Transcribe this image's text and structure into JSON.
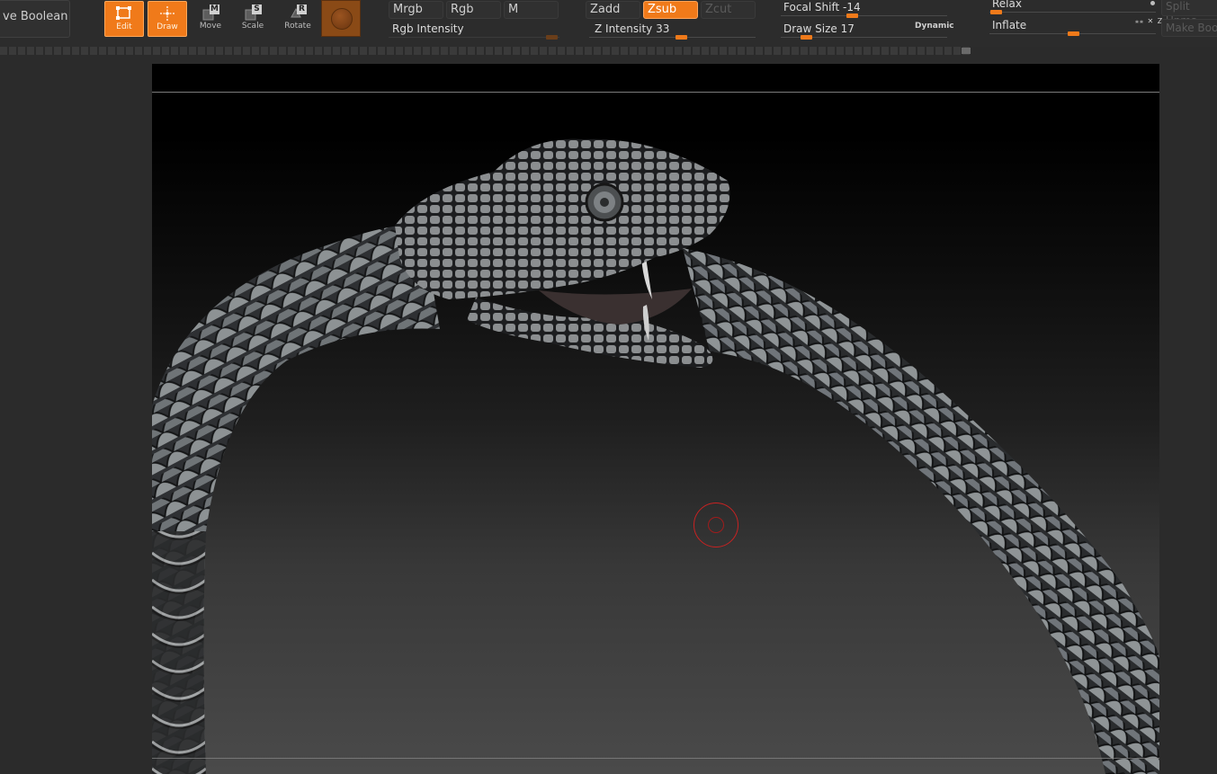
{
  "toolbar": {
    "boolean_button": "ve Boolean",
    "tools": {
      "edit": "Edit",
      "draw": "Draw",
      "move": "Move",
      "move_key": "M",
      "scale": "Scale",
      "scale_key": "S",
      "rotate": "Rotate",
      "rotate_key": "R"
    },
    "color_modes": {
      "mrgb": "Mrgb",
      "rgb": "Rgb",
      "m": "M",
      "rgb_intensity": "Rgb Intensity"
    },
    "depth_modes": {
      "zadd": "Zadd",
      "zsub": "Zsub",
      "zcut": "Zcut",
      "z_intensity_label": "Z Intensity 33",
      "z_intensity_value": 33
    },
    "brush": {
      "focal_shift_label": "Focal Shift -14",
      "focal_shift_value": -14,
      "draw_size_label": "Draw Size 17",
      "draw_size_value": 17,
      "dynamic": "Dynamic"
    },
    "deformation": {
      "relax": "Relax",
      "inflate": "Inflate"
    },
    "right_buttons": {
      "split_unmasked": "Split Unma",
      "make_boolean": "Make Boo"
    }
  },
  "colors": {
    "accent": "#f07a1a",
    "toolbar_bg": "#2c2c2c",
    "viewport_top": "#000000",
    "brush_cursor": "#c82222"
  }
}
